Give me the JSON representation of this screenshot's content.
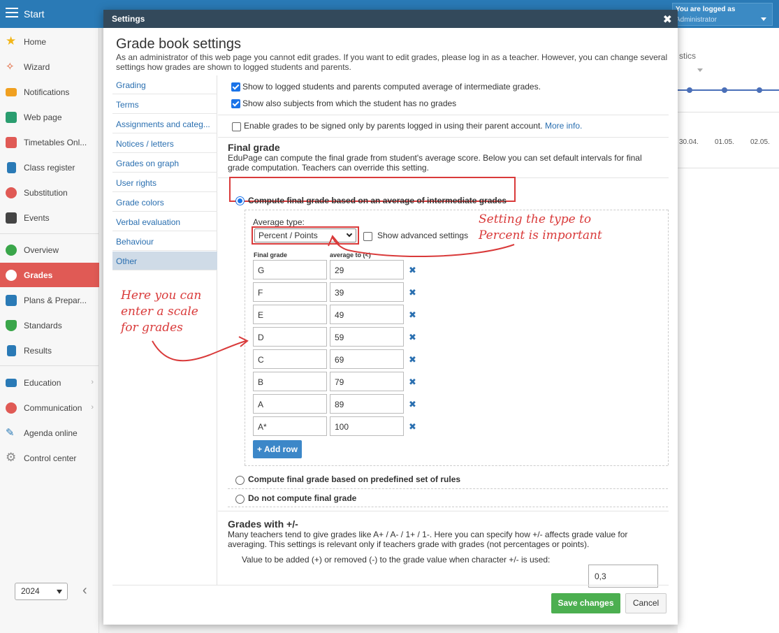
{
  "app": {
    "start_label": "Start",
    "login_line1": "You are logged as",
    "login_line2": "Administrator"
  },
  "sidebar": {
    "items": [
      {
        "label": "Home",
        "icon": "star-icon",
        "color": "#f2b619"
      },
      {
        "label": "Wizard",
        "icon": "wand-icon",
        "color": "#e05a2b"
      },
      {
        "label": "Notifications",
        "icon": "envelope-icon",
        "color": "#f0a020"
      },
      {
        "label": "Web page",
        "icon": "house-icon",
        "color": "#2a9d6f"
      },
      {
        "label": "Timetables Onl...",
        "icon": "calendar-grid-icon",
        "color": "#e05a55"
      },
      {
        "label": "Class register",
        "icon": "register-icon",
        "color": "#2a7ab6"
      },
      {
        "label": "Substitution",
        "icon": "person-icon",
        "color": "#e05a55"
      },
      {
        "label": "Events",
        "icon": "calendar-icon",
        "color": "#444"
      },
      {
        "label": "Overview",
        "icon": "check-circle-icon",
        "color": "#3aa64a"
      },
      {
        "label": "Grades",
        "icon": "grade-icon",
        "color": "#fff"
      },
      {
        "label": "Plans & Prepar...",
        "icon": "plans-icon",
        "color": "#2a7ab6"
      },
      {
        "label": "Standards",
        "icon": "shield-check-icon",
        "color": "#3aa64a"
      },
      {
        "label": "Results",
        "icon": "bar-chart-icon",
        "color": "#2a7ab6"
      },
      {
        "label": "Education",
        "icon": "book-icon",
        "color": "#2a7ab6"
      },
      {
        "label": "Communication",
        "icon": "chat-icon",
        "color": "#e05a55"
      },
      {
        "label": "Agenda online",
        "icon": "pencil-icon",
        "color": "#2a7ab6"
      },
      {
        "label": "Control center",
        "icon": "gear-icon",
        "color": "#888"
      }
    ],
    "year": "2024"
  },
  "background": {
    "stics_label": "stics",
    "dates": [
      "30.04.",
      "01.05.",
      "02.05."
    ]
  },
  "modal": {
    "title": "Settings",
    "heading": "Grade book settings",
    "description": "As an administrator of this web page you cannot edit grades. If you want to edit grades, please log in as a teacher. However, you can change several settings how grades are shown to logged students and parents.",
    "nav": [
      "Grading",
      "Terms",
      "Assignments and categ...",
      "Notices / letters",
      "Grades on graph",
      "User rights",
      "Grade colors",
      "Verbal evaluation",
      "Behaviour",
      "Other"
    ],
    "options": {
      "show_average": "Show to logged students and parents computed average of intermediate grades.",
      "show_no_grades": "Show also subjects from which the student has no grades",
      "enable_signed": "Enable grades to be signed only by parents logged in using their parent account.",
      "more_info": "More info."
    },
    "final_grade": {
      "title": "Final grade",
      "desc": "EduPage can compute the final grade from student's average score. Below you can set default intervals for final grade computation. Teachers can override this setting.",
      "radio_average": "Compute final grade based on an average of intermediate grades",
      "average_type_label": "Average type:",
      "average_type_value": "Percent / Points",
      "show_advanced": "Show advanced settings",
      "col_final": "Final grade",
      "col_average": "average to (<)",
      "rows": [
        {
          "grade": "G",
          "value": "29"
        },
        {
          "grade": "F",
          "value": "39"
        },
        {
          "grade": "E",
          "value": "49"
        },
        {
          "grade": "D",
          "value": "59"
        },
        {
          "grade": "C",
          "value": "69"
        },
        {
          "grade": "B",
          "value": "79"
        },
        {
          "grade": "A",
          "value": "89"
        },
        {
          "grade": "A*",
          "value": "100"
        }
      ],
      "add_row": "+ Add row",
      "radio_rules": "Compute final grade based on predefined set of rules",
      "radio_none": "Do not compute final grade"
    },
    "plus_minus": {
      "title": "Grades with +/-",
      "desc": "Many teachers tend to give grades like A+ / A- / 1+ / 1-. Here you can specify how +/- affects grade value for averaging. This settings is relevant only if teachers grade with grades (not percentages or points).",
      "value_label": "Value to be added (+) or removed (-) to the grade value when character +/- is used:",
      "value": "0,3"
    },
    "save": "Save changes",
    "cancel": "Cancel"
  },
  "annotations": {
    "type_note_1": "Setting the type to",
    "type_note_2": "Percent is important",
    "scale_note_1": "Here you can",
    "scale_note_2": "enter a scale",
    "scale_note_3": "for grades",
    "color": "#d93a3a"
  }
}
